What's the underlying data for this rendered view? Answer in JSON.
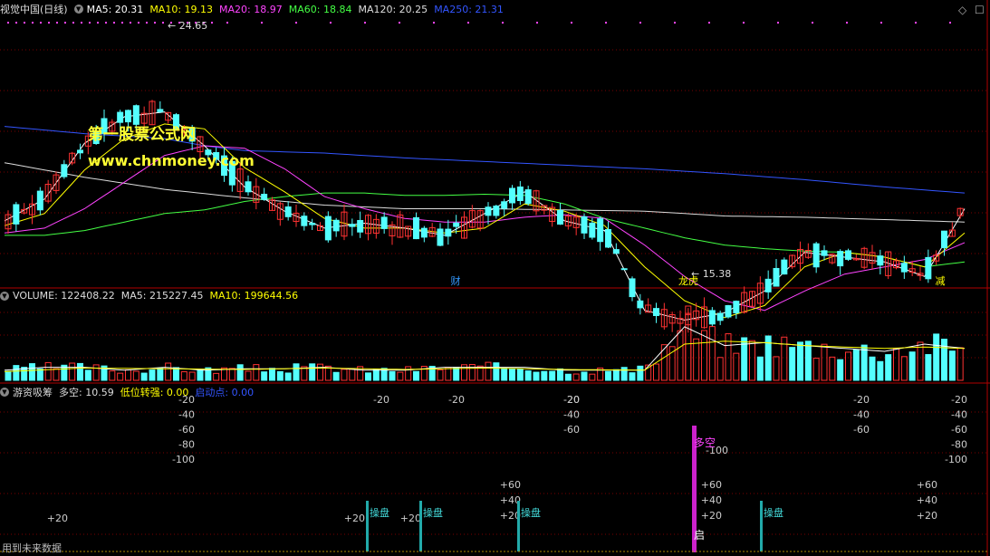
{
  "header": {
    "title": "视觉中国(日线)",
    "ma_items": [
      {
        "label": "MA5: 20.31",
        "color": "#ffffff"
      },
      {
        "label": "MA10: 19.13",
        "color": "#ffff00"
      },
      {
        "label": "MA20: 18.97",
        "color": "#ff44ff"
      },
      {
        "label": "MA60: 18.84",
        "color": "#44ff44"
      },
      {
        "label": "MA120: 20.25",
        "color": "#dddddd"
      },
      {
        "label": "MA250: 21.31",
        "color": "#3355ff"
      }
    ]
  },
  "volume_header": {
    "title": "VOLUME: 122408.22",
    "ma5": "MA5: 215227.45",
    "ma10": "MA10: 199644.56"
  },
  "indicator_header": {
    "name": "游资吸筹",
    "duokong": "多空: 10.59",
    "diwei": "低位转强: 0.00",
    "qidong": "启动点: 0.00"
  },
  "watermark": {
    "line1": "第一股票公式网",
    "line2": "www.chnmoney.com"
  },
  "footer": "用到未来数据",
  "colors": {
    "up": "#ff3232",
    "down": "#54ffff",
    "grid": "#7a0000",
    "ma5": "#ffffff",
    "ma10": "#ffff00",
    "ma20": "#ff44ff",
    "ma60": "#44ff44",
    "ma120": "#dddddd",
    "ma250": "#3355ff"
  },
  "chart_data": {
    "type": "candlestick",
    "high_label": "24.65",
    "low_label": "15.38",
    "event_labels": [
      "财",
      "龙虎",
      "减"
    ],
    "indicator_labels": {
      "duokong": "多空",
      "caopan": "操盘",
      "qi": "启"
    },
    "indicator_ticks_neg": [
      "-20",
      "-40",
      "-60",
      "-80",
      "-100"
    ],
    "indicator_ticks_pos": [
      "+20",
      "+40",
      "+60"
    ],
    "ma250": [
      [
        0,
        20.8
      ],
      [
        10,
        20.5
      ],
      [
        20,
        20.3
      ],
      [
        25,
        20.0
      ],
      [
        30,
        19.8
      ],
      [
        40,
        19.7
      ],
      [
        50,
        19.5
      ],
      [
        60,
        19.35
      ],
      [
        70,
        19.2
      ],
      [
        80,
        19.05
      ],
      [
        90,
        18.85
      ],
      [
        100,
        18.6
      ],
      [
        110,
        18.3
      ],
      [
        120,
        18.05
      ]
    ],
    "ma120": [
      [
        0,
        19.3
      ],
      [
        10,
        18.7
      ],
      [
        20,
        18.2
      ],
      [
        30,
        17.85
      ],
      [
        40,
        17.55
      ],
      [
        50,
        17.4
      ],
      [
        60,
        17.4
      ],
      [
        70,
        17.35
      ],
      [
        80,
        17.3
      ],
      [
        90,
        17.1
      ],
      [
        100,
        17.05
      ],
      [
        110,
        16.95
      ],
      [
        120,
        16.85
      ]
    ],
    "ma60": [
      [
        0,
        16.3
      ],
      [
        5,
        16.3
      ],
      [
        10,
        16.5
      ],
      [
        15,
        16.85
      ],
      [
        20,
        17.2
      ],
      [
        25,
        17.35
      ],
      [
        30,
        17.7
      ],
      [
        35,
        17.9
      ],
      [
        40,
        18.05
      ],
      [
        45,
        18.05
      ],
      [
        50,
        17.95
      ],
      [
        55,
        17.95
      ],
      [
        60,
        18.0
      ],
      [
        65,
        17.95
      ],
      [
        70,
        17.6
      ],
      [
        75,
        17.0
      ],
      [
        80,
        16.6
      ],
      [
        85,
        16.2
      ],
      [
        90,
        15.9
      ],
      [
        95,
        15.75
      ],
      [
        100,
        15.65
      ],
      [
        105,
        15.6
      ],
      [
        110,
        15.4
      ],
      [
        115,
        15.0
      ],
      [
        120,
        15.2
      ]
    ],
    "ma20": [
      [
        0,
        16.4
      ],
      [
        5,
        16.6
      ],
      [
        10,
        17.4
      ],
      [
        15,
        18.5
      ],
      [
        20,
        19.6
      ],
      [
        25,
        20.0
      ],
      [
        30,
        19.9
      ],
      [
        35,
        19.05
      ],
      [
        40,
        17.9
      ],
      [
        45,
        17.4
      ],
      [
        50,
        17.0
      ],
      [
        55,
        16.85
      ],
      [
        60,
        16.85
      ],
      [
        65,
        17.05
      ],
      [
        70,
        17.15
      ],
      [
        75,
        17.0
      ],
      [
        80,
        15.9
      ],
      [
        85,
        14.6
      ],
      [
        90,
        13.6
      ],
      [
        95,
        13.2
      ],
      [
        100,
        14.0
      ],
      [
        105,
        14.7
      ],
      [
        110,
        15.0
      ],
      [
        115,
        15.3
      ],
      [
        120,
        16.0
      ]
    ],
    "ma10": [
      [
        0,
        16.7
      ],
      [
        5,
        17.2
      ],
      [
        10,
        19.0
      ],
      [
        15,
        20.3
      ],
      [
        20,
        20.9
      ],
      [
        25,
        20.7
      ],
      [
        30,
        19.1
      ],
      [
        35,
        18.1
      ],
      [
        40,
        17.0
      ],
      [
        45,
        16.6
      ],
      [
        50,
        16.6
      ],
      [
        55,
        16.4
      ],
      [
        60,
        16.6
      ],
      [
        65,
        17.6
      ],
      [
        70,
        17.3
      ],
      [
        75,
        16.7
      ],
      [
        80,
        15.0
      ],
      [
        85,
        13.6
      ],
      [
        90,
        12.9
      ],
      [
        95,
        13.4
      ],
      [
        100,
        15.0
      ],
      [
        105,
        15.6
      ],
      [
        110,
        15.4
      ],
      [
        115,
        15.0
      ],
      [
        120,
        16.4
      ]
    ],
    "ma5": [
      [
        0,
        16.9
      ],
      [
        5,
        17.8
      ],
      [
        10,
        20.1
      ],
      [
        15,
        21.2
      ],
      [
        20,
        21.4
      ],
      [
        25,
        20.0
      ],
      [
        30,
        18.3
      ],
      [
        35,
        17.3
      ],
      [
        40,
        16.6
      ],
      [
        45,
        16.8
      ],
      [
        50,
        16.6
      ],
      [
        55,
        16.3
      ],
      [
        60,
        17.2
      ],
      [
        65,
        18.1
      ],
      [
        70,
        16.9
      ],
      [
        75,
        16.5
      ],
      [
        80,
        13.2
      ],
      [
        85,
        12.8
      ],
      [
        90,
        13.1
      ],
      [
        95,
        14.0
      ],
      [
        100,
        15.6
      ],
      [
        105,
        15.4
      ],
      [
        110,
        15.2
      ],
      [
        115,
        14.6
      ],
      [
        120,
        17.4
      ]
    ],
    "volume_ma5": [
      [
        0,
        0.7
      ],
      [
        5,
        0.9
      ],
      [
        10,
        0.9
      ],
      [
        15,
        0.7
      ],
      [
        20,
        0.9
      ],
      [
        25,
        0.7
      ],
      [
        30,
        0.8
      ],
      [
        35,
        0.8
      ],
      [
        40,
        0.9
      ],
      [
        45,
        0.7
      ],
      [
        50,
        0.7
      ],
      [
        55,
        0.9
      ],
      [
        60,
        0.9
      ],
      [
        65,
        0.9
      ],
      [
        70,
        0.7
      ],
      [
        75,
        0.7
      ],
      [
        80,
        0.7
      ],
      [
        85,
        3.7
      ],
      [
        90,
        2.4
      ],
      [
        95,
        2.6
      ],
      [
        100,
        2.4
      ],
      [
        105,
        2.2
      ],
      [
        110,
        2.0
      ],
      [
        115,
        2.5
      ],
      [
        120,
        2.2
      ]
    ],
    "volume_ma10": [
      [
        0,
        0.6
      ],
      [
        10,
        0.85
      ],
      [
        20,
        0.8
      ],
      [
        30,
        0.75
      ],
      [
        40,
        0.85
      ],
      [
        50,
        0.75
      ],
      [
        60,
        0.85
      ],
      [
        70,
        0.75
      ],
      [
        80,
        0.7
      ],
      [
        85,
        2.5
      ],
      [
        90,
        2.7
      ],
      [
        95,
        2.6
      ],
      [
        100,
        2.4
      ],
      [
        110,
        2.2
      ],
      [
        115,
        2.3
      ],
      [
        120,
        2.2
      ]
    ]
  }
}
